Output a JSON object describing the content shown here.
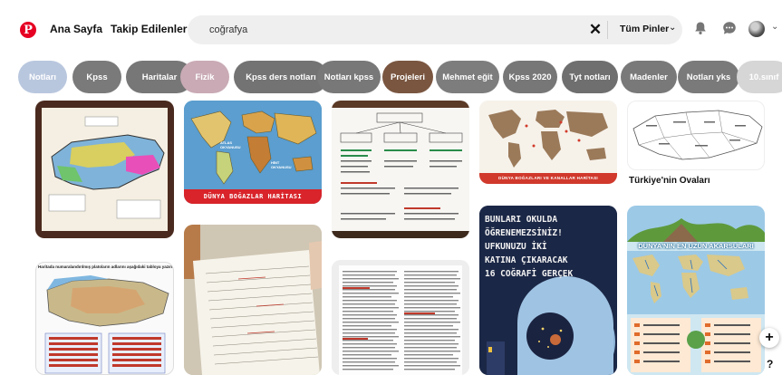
{
  "header": {
    "logo_letter": "P",
    "home_label": "Ana Sayfa",
    "following_label": "Takip Edilenler",
    "search_value": "coğrafya",
    "search_clear": "✕",
    "search_scope": "Tüm Pinler",
    "scope_chevron": "⌄",
    "account_chevron": "⌄"
  },
  "chips": [
    {
      "label": "Notları",
      "color": "#b9c7de"
    },
    {
      "label": "Kpss",
      "color": "#7a7a7a"
    },
    {
      "label": "Haritalar",
      "color": "#777777"
    },
    {
      "label": "Fizik",
      "color": "#c9aab5"
    },
    {
      "label": "Kpss ders notları",
      "color": "#737373"
    },
    {
      "label": "Notları kpss",
      "color": "#787878"
    },
    {
      "label": "Projeleri",
      "color": "#7a5640"
    },
    {
      "label": "Mehmet eğit",
      "color": "#7d7d7d"
    },
    {
      "label": "Kpss 2020",
      "color": "#777777"
    },
    {
      "label": "Tyt notları",
      "color": "#6f6f6f"
    },
    {
      "label": "Madenler",
      "color": "#797979"
    },
    {
      "label": "Notları yks",
      "color": "#7a7a7a"
    },
    {
      "label": "10.sınıf",
      "color": "#d6d6d6"
    }
  ],
  "pins": {
    "world_straits_title": "DÜNYA BOĞAZLAR HARİTASI",
    "map_label_1": "ATLAS OKYANUSU",
    "map_label_2": "HİNT OKYANUSU",
    "small_map_caption": "DÜNYA BOĞAZLARI VE KANALLAR HARİTASI",
    "turkey_plains_caption": "Türkiye'nin Ovaları",
    "plateau_header": "Haritada numaralandırılmış platoların adlarını aşağıdaki tabloya yazınız.",
    "facts_lines": [
      "BUNLARI OKULDA",
      "ÖĞRENEMEZSİNİZ!",
      "UFKUNUZU İKİ",
      "KATINA ÇIKARACAK",
      "16 COĞRAFİ GERÇEK"
    ],
    "rivers_title": "DÜNYA'NIN EN UZUN AKARSULARI"
  },
  "fab_label": "+",
  "help_label": "?",
  "colors": {
    "brand": "#e60023",
    "chip_text": "#ffffff",
    "search_bg": "#efefef"
  }
}
